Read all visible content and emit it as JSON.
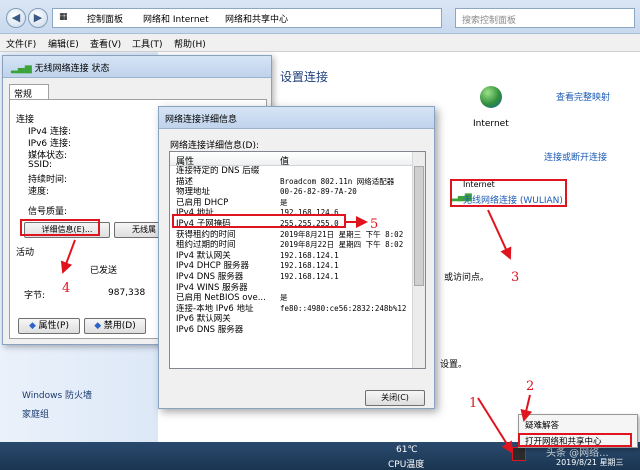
{
  "explorer": {
    "breadcrumb": [
      "控制面板",
      "网络和 Internet",
      "网络和共享中心"
    ],
    "search_placeholder": "搜索控制面板",
    "menu": [
      "文件(F)",
      "编辑(E)",
      "查看(V)",
      "工具(T)",
      "帮助(H)"
    ],
    "content_title": "设置连接",
    "full_map_link": "查看完整映射",
    "internet_label": "Internet",
    "connect_disconnect_link": "连接或断开连接",
    "internet_label2": "Internet",
    "wireless_link": "无线网络连接 (WULIAN)",
    "partial_text_1": "或访问点。",
    "partial_text_2": "设置。",
    "sidebar_links": [
      "Windows 防火墙",
      "家庭组"
    ]
  },
  "status_dialog": {
    "title": "无线网络连接 状态",
    "tab": "常规",
    "connection_section": "连接",
    "conn_labels": [
      "IPv4 连接:",
      "IPv6 连接:",
      "媒体状态:",
      "SSID:",
      "持续时间:",
      "速度:"
    ],
    "signal_label": "信号质量:",
    "details_button": "详细信息(E)...",
    "wireless_button": "无线属",
    "activity_section": "活动",
    "sent_label": "已发送",
    "bytes_label": "字节:",
    "bytes_sent": "987,338",
    "properties_button": "属性(P)",
    "disable_button": "禁用(D)"
  },
  "details_dialog": {
    "title": "网络连接详细信息",
    "list_label": "网络连接详细信息(D):",
    "col_property": "属性",
    "col_value": "值",
    "rows": [
      {
        "p": "连接特定的 DNS 后缀",
        "v": ""
      },
      {
        "p": "描述",
        "v": "Broadcom 802.11n 网络适配器"
      },
      {
        "p": "物理地址",
        "v": "00-26-82-89-7A-20"
      },
      {
        "p": "已启用 DHCP",
        "v": "是"
      },
      {
        "p": "IPv4 地址",
        "v": "192.168.124.6"
      },
      {
        "p": "IPv4 子网掩码",
        "v": "255.255.255.0"
      },
      {
        "p": "获得租约的时间",
        "v": "2019年8月21日 星期三 下午 8:02"
      },
      {
        "p": "租约过期的时间",
        "v": "2019年8月22日 星期四 下午 8:02"
      },
      {
        "p": "IPv4 默认网关",
        "v": "192.168.124.1"
      },
      {
        "p": "IPv4 DHCP 服务器",
        "v": "192.168.124.1"
      },
      {
        "p": "IPv4 DNS 服务器",
        "v": "192.168.124.1"
      },
      {
        "p": "IPv4 WINS 服务器",
        "v": ""
      },
      {
        "p": "已启用 NetBIOS ove...",
        "v": "是"
      },
      {
        "p": "连接-本地 IPv6 地址",
        "v": "fe80::4980:ce56:2832:248b%12"
      },
      {
        "p": "IPv6 默认网关",
        "v": ""
      },
      {
        "p": "IPv6 DNS 服务器",
        "v": ""
      }
    ],
    "close_button": "关闭(C)"
  },
  "annotations": [
    "1",
    "2",
    "3",
    "4",
    "5"
  ],
  "tray": {
    "temp": "61℃",
    "temp_label": "CPU温度",
    "date": "2019/8/21 星期三",
    "watermark": "头条 @网络..."
  },
  "context_menu": [
    "疑难解答",
    "打开网络和共享中心"
  ],
  "colors": {
    "annotation_red": "#e0141e",
    "link_blue": "#1c5bb6"
  }
}
